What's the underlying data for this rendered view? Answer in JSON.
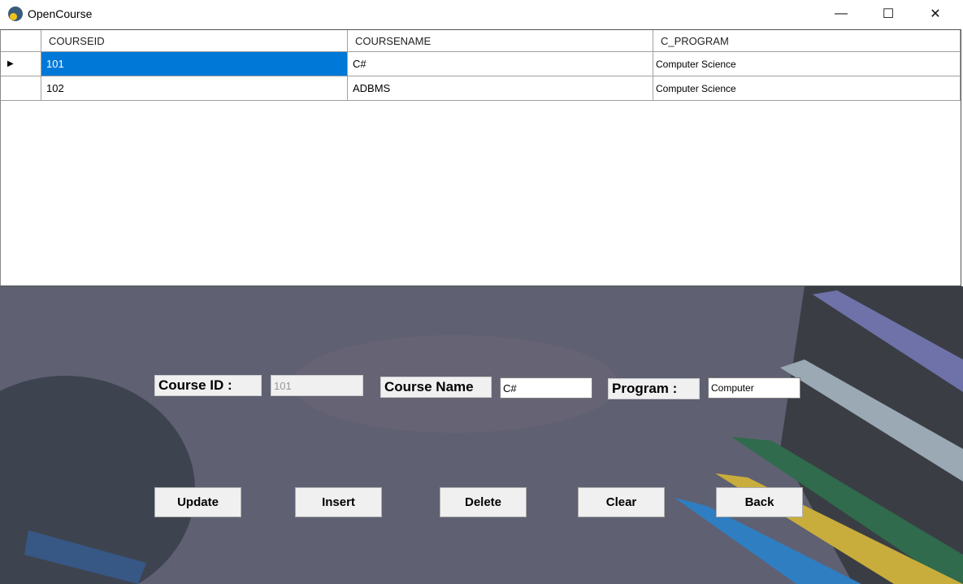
{
  "window": {
    "title": "OpenCourse",
    "minimize": "—",
    "maximize": "☐",
    "close": "✕"
  },
  "grid": {
    "columns": [
      "COURSEID",
      "COURSENAME",
      "C_PROGRAM"
    ],
    "rows": [
      [
        "101",
        "C#",
        "Computer Science"
      ],
      [
        "102",
        "ADBMS",
        "Computer Science"
      ]
    ],
    "selected_row": 0
  },
  "form": {
    "course_id_label": "Course ID :",
    "course_id_value": "101",
    "course_name_label": "Course Name",
    "course_name_value": "C#",
    "program_label": "Program :",
    "program_value": "Computer"
  },
  "buttons": {
    "update": "Update",
    "insert": "Insert",
    "delete": "Delete",
    "clear": "Clear",
    "back": "Back"
  }
}
